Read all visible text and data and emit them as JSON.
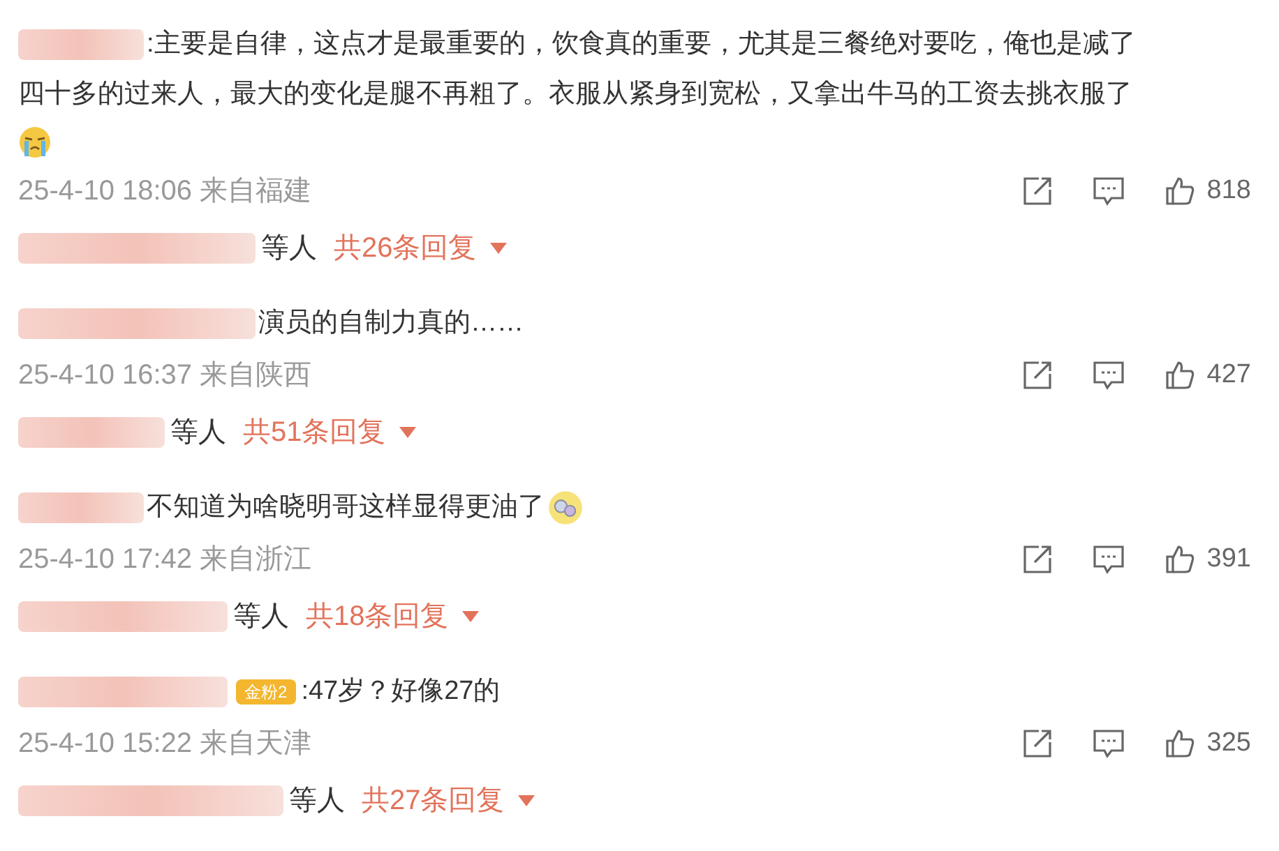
{
  "comments": [
    {
      "lines": [
        [
          {
            "kind": "text",
            "text": ":主要是自律，这点才是最重要的，饮食真的重要，尤其是三餐绝对要吃，俺也是减了"
          }
        ],
        [
          {
            "kind": "text",
            "text": "四十多的过来人，最大的变化是腿不再粗了。衣服从紧身到宽松，又拿出牛马的工资去挑衣服了"
          }
        ],
        [
          {
            "kind": "crying_emoji"
          }
        ]
      ],
      "meta": "25-4-10 18:06 来自福建",
      "likes": "818",
      "replies_suffix": "等人",
      "replies_link": "共26条回复"
    },
    {
      "lines": [
        [
          {
            "kind": "text",
            "text": "演员的自制力真的……"
          }
        ]
      ],
      "meta": "25-4-10 16:37 来自陕西",
      "likes": "427",
      "replies_suffix": "等人",
      "replies_link": "共51条回复"
    },
    {
      "lines": [
        [
          {
            "kind": "text",
            "text": "不知道为啥晓明哥这样显得更油了"
          },
          {
            "kind": "dizzy_emoji"
          }
        ]
      ],
      "meta": "25-4-10 17:42 来自浙江",
      "likes": "391",
      "replies_suffix": "等人",
      "replies_link": "共18条回复"
    },
    {
      "badge": "金粉2",
      "lines": [
        [
          {
            "kind": "text",
            "text": ":47岁？好像27的"
          }
        ]
      ],
      "meta": "25-4-10 15:22 来自天津",
      "likes": "325",
      "replies_suffix": "等人",
      "replies_link": "共27条回复"
    }
  ]
}
